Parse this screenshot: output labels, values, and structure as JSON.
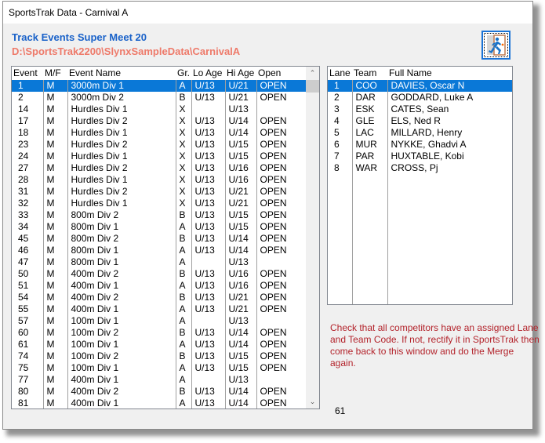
{
  "window": {
    "title": "SportsTrak Data - Carnival A"
  },
  "header": {
    "title": "Track Events  Super Meet 20",
    "path": "D:\\SportsTrak2200\\SlynxSampleData\\CarnivalA",
    "exit_button": "exit-icon"
  },
  "events": {
    "columns": [
      "Event",
      "M/F",
      "Event Name",
      "Gr.",
      "Lo Age",
      "Hi Age",
      "Open"
    ],
    "selected_index": 0,
    "rows": [
      [
        "1",
        "M",
        "3000m Div 1",
        "A",
        "U/13",
        "U/21",
        "OPEN"
      ],
      [
        "2",
        "M",
        "3000m Div 2",
        "B",
        "U/13",
        "U/21",
        "OPEN"
      ],
      [
        "14",
        "M",
        "Hurdles Div 1",
        "X",
        "",
        "U/13",
        ""
      ],
      [
        "17",
        "M",
        "Hurdles Div 2",
        "X",
        "U/13",
        "U/14",
        "OPEN"
      ],
      [
        "18",
        "M",
        "Hurdles Div 1",
        "X",
        "U/13",
        "U/14",
        "OPEN"
      ],
      [
        "23",
        "M",
        "Hurdles Div 2",
        "X",
        "U/13",
        "U/15",
        "OPEN"
      ],
      [
        "24",
        "M",
        "Hurdles Div 1",
        "X",
        "U/13",
        "U/15",
        "OPEN"
      ],
      [
        "27",
        "M",
        "Hurdles Div 2",
        "X",
        "U/13",
        "U/16",
        "OPEN"
      ],
      [
        "28",
        "M",
        "Hurdles Div 1",
        "X",
        "U/13",
        "U/16",
        "OPEN"
      ],
      [
        "31",
        "M",
        "Hurdles Div 2",
        "X",
        "U/13",
        "U/21",
        "OPEN"
      ],
      [
        "32",
        "M",
        "Hurdles Div 1",
        "X",
        "U/13",
        "U/21",
        "OPEN"
      ],
      [
        "33",
        "M",
        "800m Div 2",
        "B",
        "U/13",
        "U/15",
        "OPEN"
      ],
      [
        "34",
        "M",
        "800m Div 1",
        "A",
        "U/13",
        "U/15",
        "OPEN"
      ],
      [
        "45",
        "M",
        "800m Div 2",
        "B",
        "U/13",
        "U/14",
        "OPEN"
      ],
      [
        "46",
        "M",
        "800m Div 1",
        "A",
        "U/13",
        "U/14",
        "OPEN"
      ],
      [
        "47",
        "M",
        "800m Div 1",
        "A",
        "",
        "U/13",
        ""
      ],
      [
        "50",
        "M",
        "400m Div 2",
        "B",
        "U/13",
        "U/16",
        "OPEN"
      ],
      [
        "51",
        "M",
        "400m Div 1",
        "A",
        "U/13",
        "U/16",
        "OPEN"
      ],
      [
        "54",
        "M",
        "400m Div 2",
        "B",
        "U/13",
        "U/21",
        "OPEN"
      ],
      [
        "55",
        "M",
        "400m Div 1",
        "A",
        "U/13",
        "U/21",
        "OPEN"
      ],
      [
        "57",
        "M",
        "100m Div 1",
        "A",
        "",
        "U/13",
        ""
      ],
      [
        "60",
        "M",
        "100m Div 2",
        "B",
        "U/13",
        "U/14",
        "OPEN"
      ],
      [
        "61",
        "M",
        "100m Div 1",
        "A",
        "U/13",
        "U/14",
        "OPEN"
      ],
      [
        "74",
        "M",
        "100m Div 2",
        "B",
        "U/13",
        "U/15",
        "OPEN"
      ],
      [
        "75",
        "M",
        "100m Div 1",
        "A",
        "U/13",
        "U/15",
        "OPEN"
      ],
      [
        "77",
        "M",
        "400m Div 1",
        "A",
        "",
        "U/13",
        ""
      ],
      [
        "80",
        "M",
        "400m Div 2",
        "B",
        "U/13",
        "U/14",
        "OPEN"
      ],
      [
        "81",
        "M",
        "400m Div 1",
        "A",
        "U/13",
        "U/14",
        "OPEN"
      ]
    ]
  },
  "competitors": {
    "columns": [
      "Lane",
      "Team",
      "Full Name"
    ],
    "selected_index": 0,
    "rows": [
      [
        "1",
        "COO",
        "DAVIES, Oscar N"
      ],
      [
        "2",
        "DAR",
        "GODDARD, Luke A"
      ],
      [
        "3",
        "ESK",
        "CATES, Sean"
      ],
      [
        "4",
        "GLE",
        "ELS, Ned R"
      ],
      [
        "5",
        "LAC",
        "MILLARD, Henry"
      ],
      [
        "6",
        "MUR",
        "NYKKE, Ghadvi A"
      ],
      [
        "7",
        "PAR",
        "HUXTABLE, Kobi"
      ],
      [
        "8",
        "WAR",
        "CROSS, Pj"
      ]
    ]
  },
  "note": "Check that all competitors have an assigned Lane and Team Code.  If not, rectify it in SportsTrak then come back to this window and do the Merge again.",
  "count": "61",
  "colors": {
    "title_blue": "#1a62c9",
    "path_salmon": "#ee7a6a",
    "selection": "#0a78d7",
    "note_red": "#b3232b"
  }
}
